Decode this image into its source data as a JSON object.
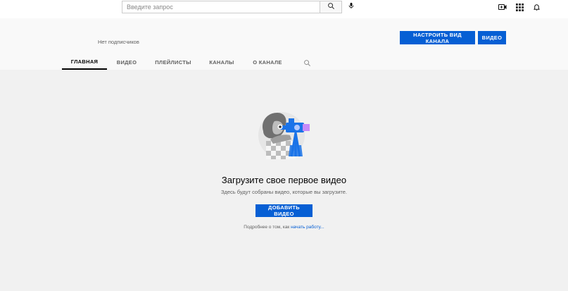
{
  "search": {
    "placeholder": "Введите запрос"
  },
  "icons": {
    "search": "search-icon",
    "mic": "mic-icon",
    "create": "create-video-icon",
    "apps": "apps-grid-icon",
    "notifications": "bell-icon",
    "channel_search": "search-icon"
  },
  "channel": {
    "subscribers": "Нет подписчиков",
    "customize_label": "НАСТРОИТЬ ВИД КАНАЛА",
    "video_label": "ВИДЕО"
  },
  "tabs": [
    {
      "label": "ГЛАВНАЯ",
      "active": true
    },
    {
      "label": "ВИДЕО"
    },
    {
      "label": "ПЛЕЙЛИСТЫ"
    },
    {
      "label": "КАНАЛЫ"
    },
    {
      "label": "О КАНАЛЕ"
    }
  ],
  "empty_state": {
    "title": "Загрузите свое первое видео",
    "subtitle": "Здесь будут собраны видео, которые вы загрузите.",
    "add_button": "ДОБАВИТЬ ВИДЕО",
    "learn_more_prefix": "Подробнее о том, как ",
    "learn_more_link": "начать работу..."
  },
  "colors": {
    "accent": "#065fd4",
    "page_bg": "#f1f1f1",
    "header_bg": "#f9f9f9"
  }
}
